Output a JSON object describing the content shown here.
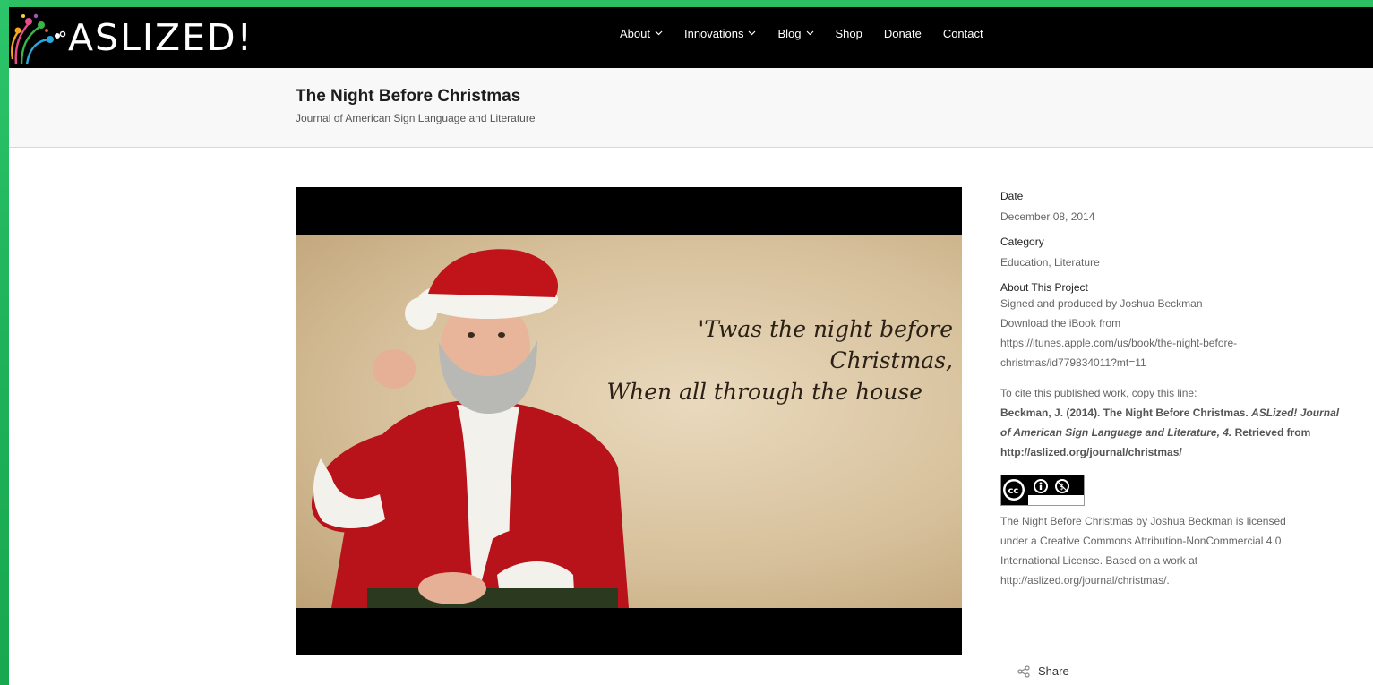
{
  "site": {
    "logo_text": "ASLIZED!"
  },
  "nav": {
    "items": [
      {
        "label": "About",
        "has_dropdown": true
      },
      {
        "label": "Innovations",
        "has_dropdown": true
      },
      {
        "label": "Blog",
        "has_dropdown": true
      },
      {
        "label": "Shop",
        "has_dropdown": false
      },
      {
        "label": "Donate",
        "has_dropdown": false
      },
      {
        "label": "Contact",
        "has_dropdown": false
      }
    ]
  },
  "page": {
    "title": "The Night Before Christmas",
    "subtitle": "Journal of American Sign Language and Literature"
  },
  "video": {
    "caption_line1": "'Twas the night before Christmas,",
    "caption_line2": "When all through the house"
  },
  "sidebar": {
    "date_label": "Date",
    "date_value": "December 08, 2014",
    "category_label": "Category",
    "category_value": "Education, Literature",
    "about_label": "About This Project",
    "about_lines": [
      "Signed and produced by Joshua Beckman",
      "Download the iBook from",
      "https://itunes.apple.com/us/book/the-night-before-",
      "christmas/id779834011?mt=11"
    ],
    "cite_intro": "To cite this published work, copy this line:",
    "cite_part1": "Beckman, J. (2014). The Night Before Christmas. ",
    "cite_italic": "ASLized! Journal of American Sign Language and Literature, 4.",
    "cite_part2": " Retrieved from http://aslized.org/journal/christmas/",
    "cc_badge": {
      "by": "BY",
      "nc": "NC"
    },
    "license_lines": [
      "The Night Before Christmas by Joshua Beckman is licensed",
      "under a Creative Commons Attribution-NonCommercial 4.0",
      "International License. Based on a work at",
      "http://aslized.org/journal/christmas/."
    ],
    "share_label": "Share"
  },
  "colors": {
    "accent_green": "#2dbf63",
    "header_bg": "#000000",
    "title_band_bg": "#f8f8f8",
    "santa_red": "#c0141a"
  },
  "icons": {
    "logo": "colorful-fireworks-logo-icon",
    "chevron": "chevron-down-icon",
    "share": "share-icon",
    "cc": "creative-commons-icon"
  }
}
